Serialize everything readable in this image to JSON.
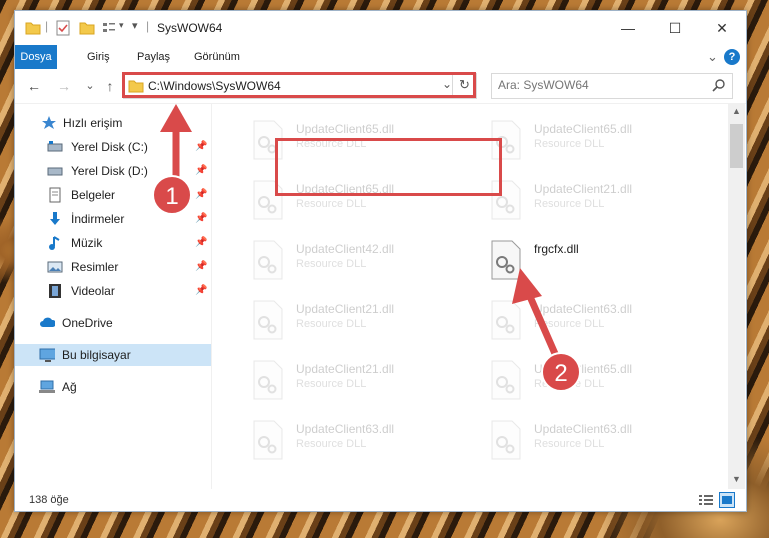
{
  "window": {
    "title": "SysWOW64",
    "controls": {
      "minimize": "—",
      "maximize": "☐",
      "close": "✕"
    }
  },
  "ribbon": {
    "tabs": [
      "Dosya",
      "Giriş",
      "Paylaş",
      "Görünüm"
    ],
    "expand_glyph": "⌄",
    "help_glyph": "?"
  },
  "navigation": {
    "back": "←",
    "forward": "→",
    "recent": "⌄",
    "up": "↑",
    "address": "C:\\Windows\\SysWOW64",
    "search_placeholder": "Ara: SysWOW64"
  },
  "sidebar": {
    "items": [
      {
        "label": "Hızlı erişim",
        "icon": "star-icon",
        "pinned": false
      },
      {
        "label": "Yerel Disk (C:)",
        "icon": "drive-icon",
        "pinned": true
      },
      {
        "label": "Yerel Disk (D:)",
        "icon": "drive-icon",
        "pinned": true
      },
      {
        "label": "Belgeler",
        "icon": "documents-icon",
        "pinned": true
      },
      {
        "label": "İndirmeler",
        "icon": "download-icon",
        "pinned": true
      },
      {
        "label": "Müzik",
        "icon": "music-icon",
        "pinned": true
      },
      {
        "label": "Resimler",
        "icon": "pictures-icon",
        "pinned": true
      },
      {
        "label": "Videolar",
        "icon": "video-icon",
        "pinned": true
      },
      {
        "label": "OneDrive",
        "icon": "cloud-icon",
        "pinned": false
      },
      {
        "label": "Bu bilgisayar",
        "icon": "computer-icon",
        "pinned": false,
        "selected": true
      },
      {
        "label": "Ağ",
        "icon": "network-icon",
        "pinned": false
      }
    ]
  },
  "files": [
    {
      "name": "UpdateClient65.dll",
      "type": "Resource DLL",
      "faded": true
    },
    {
      "name": "UpdateClient65.dll",
      "type": "Resource DLL",
      "faded": true
    },
    {
      "name": "UpdateClient65.dll",
      "type": "Resource DLL",
      "faded": true
    },
    {
      "name": "UpdateClient21.dll",
      "type": "Resource DLL",
      "faded": true
    },
    {
      "name": "UpdateClient42.dll",
      "type": "Resource DLL",
      "faded": true
    },
    {
      "name": "frgcfx.dll",
      "type": "",
      "faded": false
    },
    {
      "name": "UpdateClient21.dll",
      "type": "Resource DLL",
      "faded": true
    },
    {
      "name": "UpdateClient63.dll",
      "type": "Resource DLL",
      "faded": true
    },
    {
      "name": "UpdateClient21.dll",
      "type": "Resource DLL",
      "faded": true
    },
    {
      "name": "UpdateClient65.dll",
      "type": "Resource DLL",
      "faded": true
    },
    {
      "name": "UpdateClient63.dll",
      "type": "Resource DLL",
      "faded": true
    },
    {
      "name": "UpdateClient63.dll",
      "type": "Resource DLL",
      "faded": true
    }
  ],
  "status": {
    "item_count": "138 öğe"
  },
  "annotations": {
    "step1": "1",
    "step2": "2",
    "accent": "#d94a4a"
  },
  "colors": {
    "ribbon_active": "#1979ca",
    "selection": "#cce4f7"
  }
}
